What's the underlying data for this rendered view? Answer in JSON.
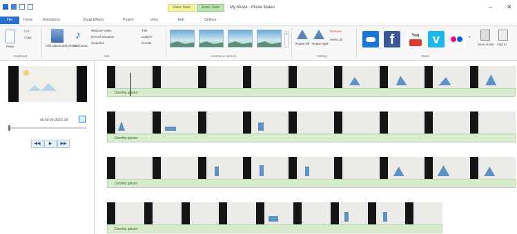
{
  "window": {
    "title": "My Movie - Movie Maker",
    "context_tabs": {
      "video_tools": "Video Tools",
      "music_tools": "Music Tools"
    },
    "controls": {
      "minimize": "–",
      "close": "✕"
    }
  },
  "tabs": [
    "File",
    "Home",
    "Animations",
    "Visual Effects",
    "Project",
    "View",
    "Edit",
    "Options"
  ],
  "ribbon": {
    "clipboard": {
      "paste": "Paste",
      "cut": "Cut",
      "copy": "Copy",
      "label": "Clipboard"
    },
    "add": {
      "add_videos": "Add videos and photos",
      "add_music": "Add music",
      "webcam": "Webcam video",
      "record_narration": "Record narration",
      "snapshot": "Snapshot",
      "title": "Title",
      "caption": "Caption",
      "credits": "Credits",
      "label": "Add"
    },
    "themes_label": "AutoMovie themes",
    "editing": {
      "rotate_left": "Rotate left",
      "rotate_right": "Rotate right",
      "remove": "Remove",
      "select_all": "Select all",
      "label": "Editing"
    },
    "share": {
      "label": "Share",
      "save_movie": "Save movie",
      "sign_in": "Sign in"
    },
    "icons": {
      "onedrive": "onedrive-icon",
      "facebook": "facebook-icon",
      "youtube": "youtube-icon",
      "vimeo": "vimeo-icon",
      "flickr": "flickr-icon"
    },
    "colors": {
      "file_tab": "#2a6fc9",
      "onedrive": "#1a75d8",
      "facebook": "#3b5998",
      "youtube": "#e03a2f",
      "vimeo": "#1ab7ea",
      "flickr_pink": "#ff0084",
      "flickr_blue": "#0063dc"
    }
  },
  "preview": {
    "time": "00:00:00.00/01:28",
    "buttons": {
      "previous": "◀◀",
      "play": "▶",
      "next": "▶▶"
    }
  },
  "storyboard": {
    "audio_label": "Dorothy glacier",
    "rows": [
      {
        "frames": 9,
        "row_label": "Dorothy glacier"
      },
      {
        "frames": 9,
        "row_label": "Dorothy glacier"
      },
      {
        "frames": 9,
        "row_label": "Dorothy glacier"
      },
      {
        "frames": 9,
        "row_label": "Dorothy glacier"
      }
    ]
  }
}
